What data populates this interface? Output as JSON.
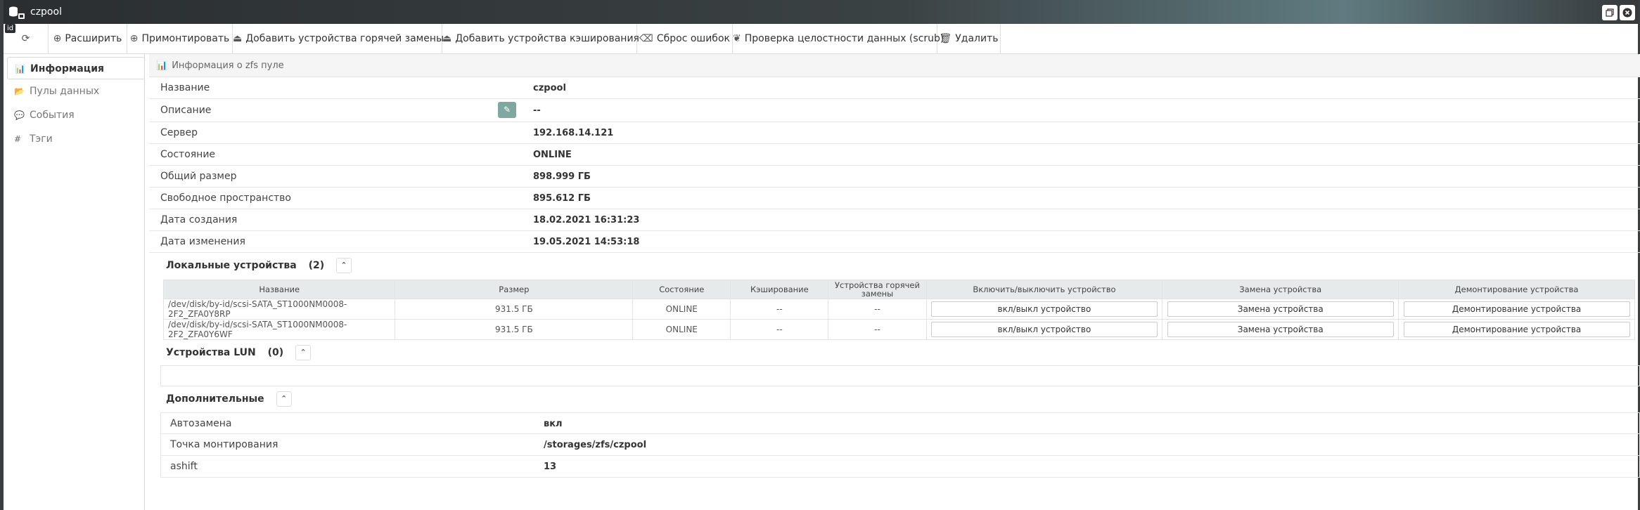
{
  "window": {
    "title": "czpool",
    "id_tag": "id"
  },
  "toolbar": {
    "items": [
      {
        "label": "Расширить",
        "icon": "plus-circle-icon"
      },
      {
        "label": "Примонтировать",
        "icon": "plus-circle-icon"
      },
      {
        "label": "Добавить устройства горячей замены",
        "icon": "hdd-icon"
      },
      {
        "label": "Добавить устройства кэширования",
        "icon": "hdd-icon"
      },
      {
        "label": "Сброс ошибок",
        "icon": "eraser-icon"
      },
      {
        "label": "Проверка целостности данных (scrub)",
        "icon": "leaf-icon"
      },
      {
        "label": "Удалить",
        "icon": "trash-icon"
      }
    ]
  },
  "sidebar": {
    "items": [
      {
        "label": "Информация",
        "icon": "bar-chart-icon",
        "active": true
      },
      {
        "label": "Пулы данных",
        "icon": "folder-icon",
        "active": false
      },
      {
        "label": "События",
        "icon": "comment-icon",
        "active": false
      },
      {
        "label": "Тэги",
        "icon": "hashtag-icon",
        "active": false
      }
    ]
  },
  "info": {
    "heading": "Информация о zfs пуле",
    "rows": [
      {
        "key": "Название",
        "value": "czpool"
      },
      {
        "key": "Описание",
        "value": "--"
      },
      {
        "key": "Сервер",
        "value": "192.168.14.121"
      },
      {
        "key": "Состояние",
        "value": "ONLINE"
      },
      {
        "key": "Общий размер",
        "value": "898.999 ГБ"
      },
      {
        "key": "Свободное пространство",
        "value": "895.612 ГБ"
      },
      {
        "key": "Дата создания",
        "value": "18.02.2021 16:31:23"
      },
      {
        "key": "Дата изменения",
        "value": "19.05.2021 14:53:18"
      }
    ]
  },
  "local_devices": {
    "title": "Локальные устройства",
    "count": "(2)",
    "columns": [
      "Название",
      "Размер",
      "Состояние",
      "Кэширование",
      "Устройства горячей замены",
      "Включить/выключить устройство",
      "Замена устройства",
      "Демонтирование устройства"
    ],
    "rows": [
      {
        "name": "/dev/disk/by-id/scsi-SATA_ST1000NM0008-2F2_ZFA0Y8RP",
        "size": "931.5 ГБ",
        "state": "ONLINE",
        "cache": "--",
        "hot": "--",
        "toggle": "вкл/выкл устройство",
        "replace": "Замена устройства",
        "unmount": "Демонтирование устройства"
      },
      {
        "name": "/dev/disk/by-id/scsi-SATA_ST1000NM0008-2F2_ZFA0Y6WF",
        "size": "931.5 ГБ",
        "state": "ONLINE",
        "cache": "--",
        "hot": "--",
        "toggle": "вкл/выкл устройство",
        "replace": "Замена устройства",
        "unmount": "Демонтирование устройства"
      }
    ]
  },
  "lun_devices": {
    "title": "Устройства LUN",
    "count": "(0)"
  },
  "extra": {
    "title": "Дополнительные",
    "rows": [
      {
        "key": "Автозамена",
        "value": "вкл"
      },
      {
        "key": "Точка монтирования",
        "value": "/storages/zfs/czpool"
      },
      {
        "key": "ashift",
        "value": "13"
      }
    ]
  }
}
